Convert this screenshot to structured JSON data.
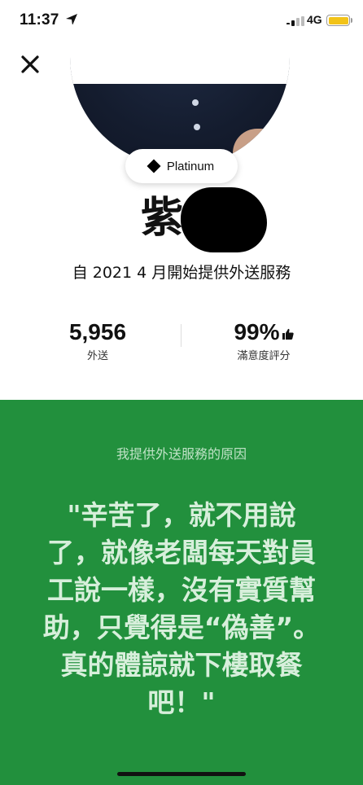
{
  "status_bar": {
    "time": "11:37",
    "network": "4G",
    "battery_color": "#f2c318"
  },
  "icons": {
    "close": "close-icon",
    "location": "location-arrow-icon",
    "badge": "diamond-icon",
    "thumb": "thumbs-up-icon"
  },
  "profile": {
    "badge_label": "Platinum",
    "name_visible": "紫",
    "since": "自 2021 4 月開始提供外送服務"
  },
  "stats": {
    "deliveries_value": "5,956",
    "deliveries_label": "外送",
    "rating_value": "99%",
    "rating_label": "滿意度評分"
  },
  "reason": {
    "title": "我提供外送服務的原因",
    "quote": "\"辛苦了，就不用說了，就像老闆每天對員工說一樣，沒有實質幫助，只覺得是“偽善”。真的體諒就下樓取餐吧！\""
  },
  "colors": {
    "panel_green": "#22903d",
    "text_light_green": "#d7efdb"
  }
}
